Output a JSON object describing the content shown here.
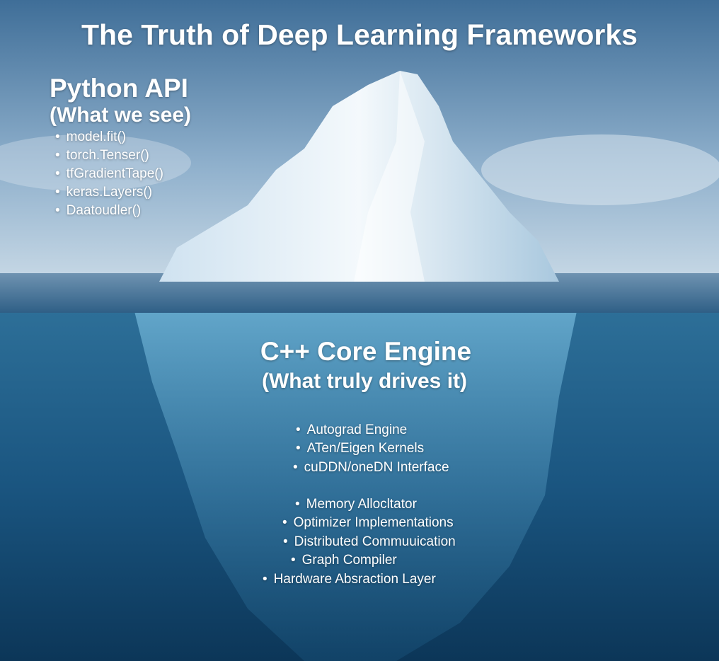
{
  "title": "The Truth of Deep Learning Frameworks",
  "above": {
    "heading": "Python API",
    "subheading": "(What we see)",
    "items": [
      "model.fit()",
      "torch.Tenser()",
      "tfGradientTape()",
      "keras.Layers()",
      "Daatoudler()"
    ]
  },
  "below": {
    "heading": "C++ Core Engine",
    "subheading": "(What truly drives it)",
    "items": [
      "Autograd Engine",
      "ATen/Eigen Kernels",
      "cuDDN/oneDN Interface",
      "Memory Allocltator",
      "Optimizer Implementations",
      "Distributed Commuuication",
      "Graph Compiler",
      "Hardware Absraction Layer"
    ]
  },
  "colors": {
    "sky_top": "#3f6e98",
    "sky_bottom": "#b9cfe0",
    "water_top": "#2a6a93",
    "water_bottom": "#0d3a5e",
    "ice": "#e9f3fa"
  }
}
